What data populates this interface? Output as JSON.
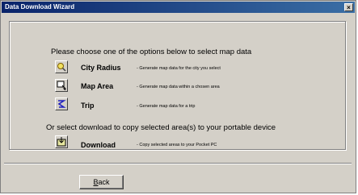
{
  "window": {
    "title": "Data Download Wizard",
    "close_glyph": "×"
  },
  "heading1": "Please choose one of the options below to select map data",
  "heading2": "Or select download to copy selected area(s) to your portable device",
  "options": [
    {
      "label": "City Radius",
      "desc": "- Generate map data for the city you select",
      "icon": "city-radius-icon"
    },
    {
      "label": "Map Area",
      "desc": "- Generate map data within a chosen area",
      "icon": "map-area-icon"
    },
    {
      "label": "Trip",
      "desc": "- Generate map data for a trip",
      "icon": "trip-icon"
    }
  ],
  "download": {
    "label": "Download",
    "desc": "- Copy selected areas to your Pocket PC",
    "icon": "download-icon"
  },
  "back_button": {
    "accel": "B",
    "rest": "ack"
  }
}
